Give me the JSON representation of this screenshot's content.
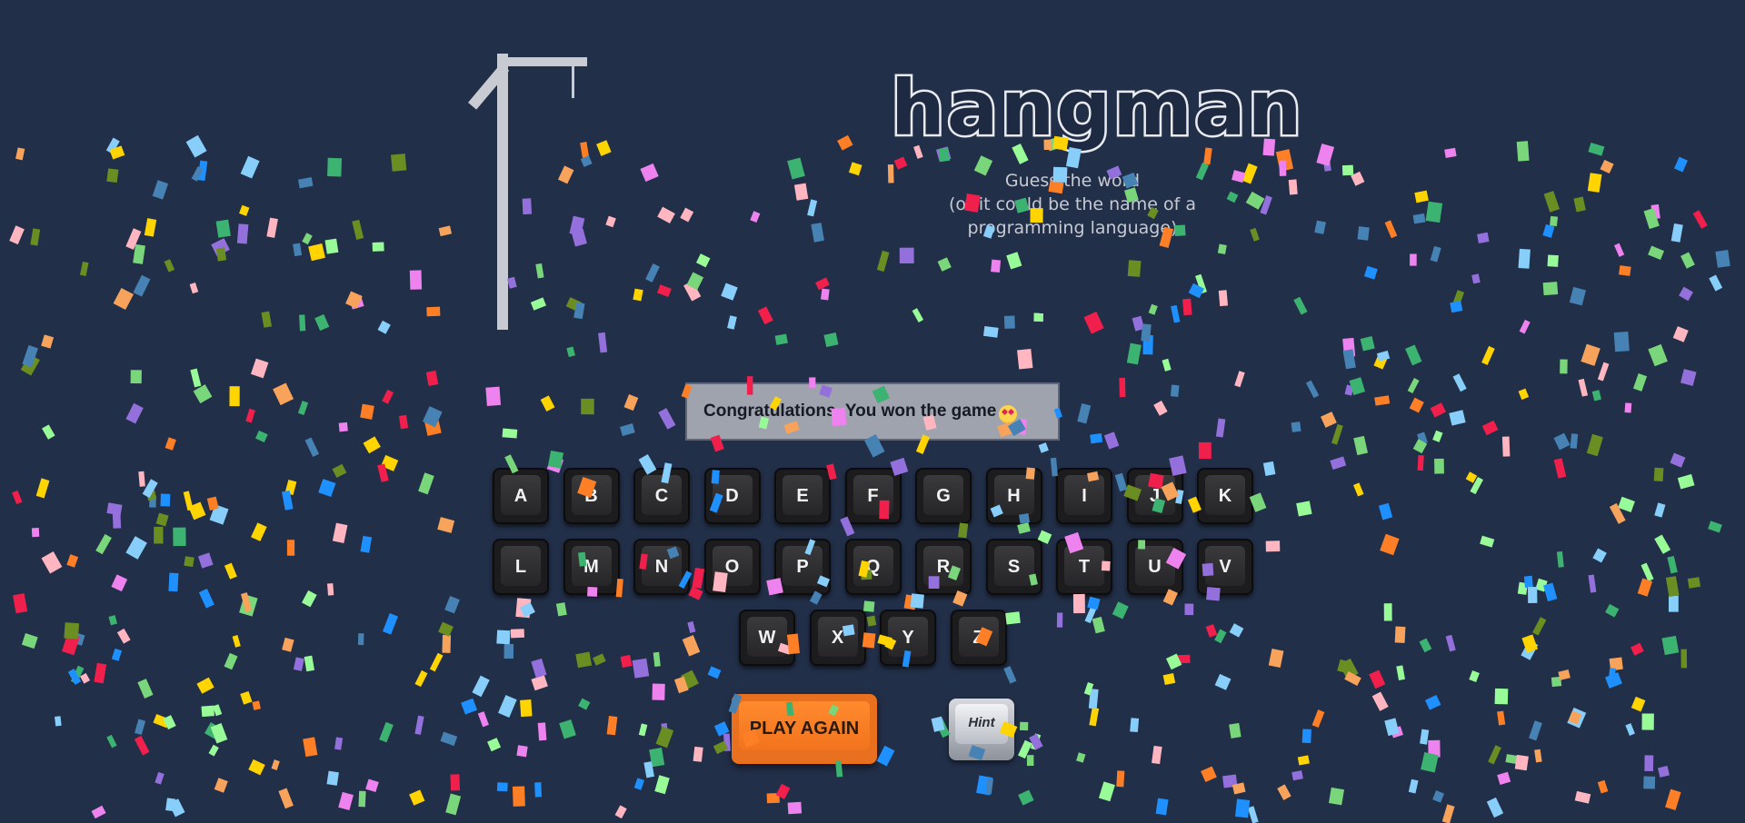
{
  "game": {
    "title": "hangman",
    "subtitle_line1": "Guess the word",
    "subtitle_line2": "(or it could be the name of a programming language)",
    "message": "Congratulations, You won the game",
    "message_icon": "star-struck-emoji-icon"
  },
  "keyboard": {
    "row1": [
      "A",
      "B",
      "C",
      "D",
      "E",
      "F",
      "G",
      "H",
      "I",
      "J",
      "K"
    ],
    "row2": [
      "L",
      "M",
      "N",
      "O",
      "P",
      "Q",
      "R",
      "S",
      "T",
      "U",
      "V"
    ],
    "row3": [
      "W",
      "X",
      "Y",
      "Z"
    ]
  },
  "buttons": {
    "play_again": "PLAY AGAIN",
    "hint": "Hint"
  },
  "colors": {
    "background": "#222f48",
    "gallows": "#c8cbd2",
    "play_button": "#e8701e",
    "confetti": [
      "#f01f4c",
      "#ffd400",
      "#1e90ff",
      "#7ad67a",
      "#f7a35c",
      "#ee82ee",
      "#9370db",
      "#87cefa",
      "#ffb6c1",
      "#3cb371",
      "#ff7f27",
      "#6b8e23",
      "#4682b4",
      "#98fb98"
    ]
  }
}
